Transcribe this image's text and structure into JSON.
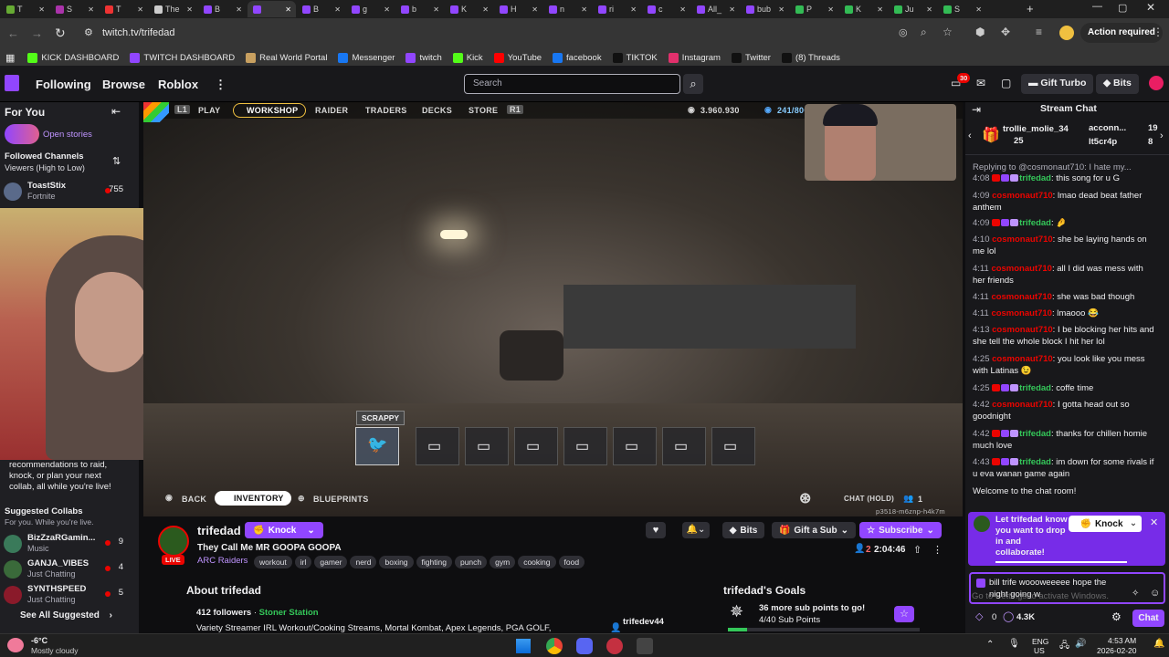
{
  "browser": {
    "tabs": [
      "T",
      "S",
      "T",
      "The",
      "B",
      "",
      "B",
      "g",
      "b",
      "K",
      "H",
      "n",
      "ri",
      "c",
      "All_",
      "bub",
      "P",
      "K",
      "Ju",
      "S"
    ],
    "url": "twitch.tv/trifedad",
    "action_required": "Action required",
    "bookmarks": [
      "KICK DASHBOARD",
      "TWITCH DASHBOARD",
      "Real World Portal",
      "Messenger",
      "twitch",
      "Kick",
      "YouTube",
      "facebook",
      "TIKTOK",
      "Instagram",
      "Twitter",
      "(8) Threads"
    ]
  },
  "topnav": {
    "following": "Following",
    "browse": "Browse",
    "roblox": "Roblox",
    "search_placeholder": "Search",
    "notif_count": "30",
    "gift_turbo": "Gift Turbo",
    "bits": "Bits"
  },
  "sidebar": {
    "for_you": "For You",
    "open_stories": "Open stories",
    "followed": "Followed Channels",
    "sort": "Viewers (High to Low)",
    "channels": [
      {
        "name": "ToastStix",
        "game": "Fortnite",
        "viewers": "755"
      }
    ],
    "raid_text": [
      "recommendations to raid,",
      "knock, or plan your next",
      "collab, all while you're live!"
    ],
    "suggested_title": "Suggested Collabs",
    "suggested_sub": "For you. While you're live.",
    "suggested": [
      {
        "name": "BizZzaRGamin...",
        "game": "Music",
        "viewers": "9"
      },
      {
        "name": "GANJA_VIBES",
        "game": "Just Chatting",
        "viewers": "4"
      },
      {
        "name": "SYNTHSPEED",
        "game": "Just Chatting",
        "viewers": "5"
      }
    ],
    "see_all": "See All Suggested"
  },
  "game": {
    "menu": [
      "PLAY",
      "WORKSHOP",
      "RAIDER",
      "TRADERS",
      "DECKS",
      "STORE"
    ],
    "currency1": "3.960.930",
    "currency2": "241/800",
    "tooltip": "SCRAPPY",
    "back": "BACK",
    "inventory": "INVENTORY",
    "blueprints": "BLUEPRINTS",
    "chat_hold": "CHAT (HOLD)",
    "party": "1",
    "session": "p3518-m6znp-h4k7m"
  },
  "stream": {
    "channel": "trifedad",
    "knock": "Knock",
    "title": "They Call Me MR GOOPA GOOPA",
    "game": "ARC Raiders",
    "live": "LIVE",
    "tags": [
      "workout",
      "irl",
      "gamer",
      "nerd",
      "boxing",
      "fighting",
      "punch",
      "gym",
      "cooking",
      "food"
    ],
    "viewers": "2",
    "uptime": "2:04:46",
    "bits": "Bits",
    "gift_sub": "Gift a Sub",
    "subscribe": "Subscribe",
    "about": "About trifedad",
    "followers": "412 followers",
    "team": "Stoner Station",
    "bio": "Variety Streamer IRL Workout/Cooking Streams, Mortal Kombat, Apex Legends, PGA GOLF,",
    "mod_name": "trifedev44",
    "goals_title": "trifedad's Goals",
    "goal_text": "36 more sub points to go!",
    "goal_progress": "4/40 Sub Points",
    "goal_fraction": 0.1
  },
  "chat": {
    "title": "Stream Chat",
    "hype": [
      {
        "name": "trollie_molie_34",
        "count": "25"
      },
      {
        "name": "acconn...",
        "count": "19"
      },
      {
        "name": "lt5cr4p",
        "count": "8"
      }
    ],
    "reply": "Replying to @cosmonaut710: I hate my...",
    "messages": [
      {
        "time": "4:08",
        "user": "trifedad",
        "text": "this song for u G",
        "streamer": true
      },
      {
        "time": "4:09",
        "user": "cosmonaut710",
        "text": "lmao dead beat father anthem",
        "streamer": false
      },
      {
        "time": "4:09",
        "user": "trifedad",
        "text": "🤌",
        "streamer": true
      },
      {
        "time": "4:10",
        "user": "cosmonaut710",
        "text": "she be laying hands on me lol",
        "streamer": false
      },
      {
        "time": "4:11",
        "user": "cosmonaut710",
        "text": "all I did was mess with her friends",
        "streamer": false
      },
      {
        "time": "4:11",
        "user": "cosmonaut710",
        "text": "she was bad though",
        "streamer": false
      },
      {
        "time": "4:11",
        "user": "cosmonaut710",
        "text": "lmaooo 😂",
        "streamer": false
      },
      {
        "time": "4:13",
        "user": "cosmonaut710",
        "text": "I be blocking her hits and she tell the whole block I hit her lol",
        "streamer": false
      },
      {
        "time": "4:25",
        "user": "cosmonaut710",
        "text": "you look like you mess with Latinas 😉",
        "streamer": false
      },
      {
        "time": "4:25",
        "user": "trifedad",
        "text": "coffe time",
        "streamer": true
      },
      {
        "time": "4:42",
        "user": "cosmonaut710",
        "text": "I gotta head out so goodnight",
        "streamer": false
      },
      {
        "time": "4:42",
        "user": "trifedad",
        "text": "thanks for chillen homie much love",
        "streamer": true
      },
      {
        "time": "4:43",
        "user": "trifedad",
        "text": "im down for some rivals if u eva wanan game again",
        "streamer": true
      }
    ],
    "welcome": "Welcome to the chat room!",
    "collab_text": "Let trifedad know you want to drop in and collaborate!",
    "knock": "Knock",
    "input_value": "bill trife woooweeeee hope the night going w",
    "activate": "Go to Settings to activate Windows.",
    "points": "0",
    "points2": "4.3K",
    "chat_button": "Chat"
  },
  "taskbar": {
    "temp": "-6°C",
    "weather": "Mostly cloudy",
    "lang1": "ENG",
    "lang2": "US",
    "time": "4:53 AM",
    "date": "2026-02-20"
  },
  "colors": {
    "twitch_purple": "#9146ff",
    "live_red": "#eb0400",
    "chat_name_red": "#eb0400",
    "streamer_green": "#34c759"
  }
}
